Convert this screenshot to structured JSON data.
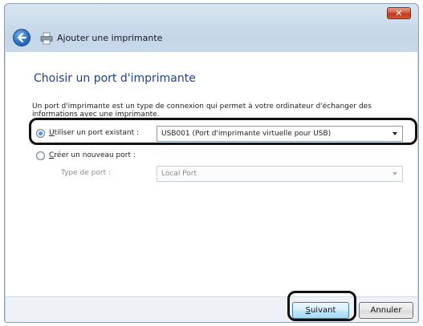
{
  "window": {
    "close_glyph": "✕",
    "close_color": "#c0361c"
  },
  "nav": {
    "title": "Ajouter une imprimante"
  },
  "main": {
    "heading": "Choisir un port d'imprimante",
    "description": "Un port d'imprimante est un type de connexion qui permet à votre ordinateur d'échanger des informations avec une imprimante.",
    "option_existing": {
      "accel": "U",
      "label_rest": "tiliser un port existant :",
      "selected": true,
      "select_value": "USB001 (Port d'imprimante virtuelle pour USB)"
    },
    "option_new": {
      "accel": "C",
      "label_rest": "réer un nouveau port :",
      "selected": false,
      "port_type_label": "Type de port :",
      "port_type_value": "Local Port"
    }
  },
  "footer": {
    "next": {
      "accel": "S",
      "label_rest": "uivant"
    },
    "cancel_label": "Annuler"
  },
  "colors": {
    "heading": "#1f3f8f",
    "accent": "#2a6fc9"
  },
  "icons": [
    "close-icon",
    "back-arrow-icon",
    "printer-icon",
    "dropdown-arrow-icon"
  ]
}
